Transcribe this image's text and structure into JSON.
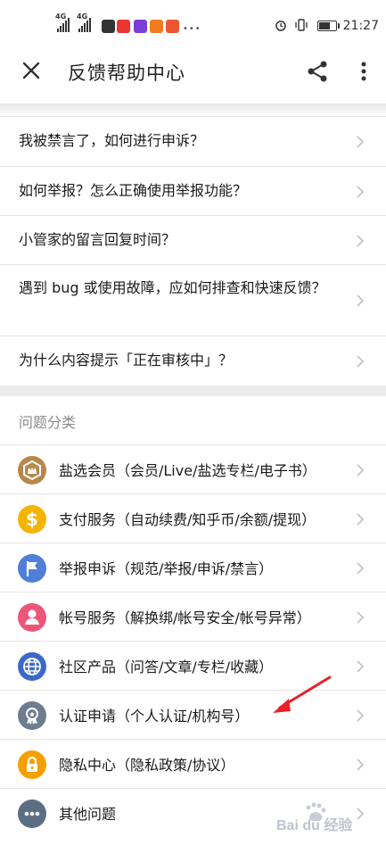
{
  "status_bar": {
    "network_1": "4G",
    "network_2": "4G",
    "time": "21:27",
    "battery_level": 0.7
  },
  "header": {
    "title": "反馈帮助中心"
  },
  "faq": [
    {
      "question": "我被禁言了，如何进行申诉？"
    },
    {
      "question": "如何举报？怎么正确使用举报功能？"
    },
    {
      "question": "小管家的留言回复时间？"
    },
    {
      "question": "遇到 bug 或使用故障，应如何排查和快速反馈？"
    },
    {
      "question": "为什么内容提示「正在审核中」？"
    }
  ],
  "categories": {
    "title": "问题分类",
    "items": [
      {
        "label": "盐选会员（会员/Live/盐选专栏/电子书）",
        "icon": "crown-icon",
        "color": "#b8874a"
      },
      {
        "label": "支付服务（自动续费/知乎币/余额/提现）",
        "icon": "dollar-icon",
        "color": "#f5b400"
      },
      {
        "label": "举报申诉（规范/举报/申诉/禁言）",
        "icon": "flag-icon",
        "color": "#4f7fd6"
      },
      {
        "label": "帐号服务（解换绑/帐号安全/帐号异常）",
        "icon": "person-icon",
        "color": "#ec5679"
      },
      {
        "label": "社区产品（问答/文章/专栏/收藏）",
        "icon": "globe-icon",
        "color": "#3c69c9"
      },
      {
        "label": "认证申请（个人认证/机构号）",
        "icon": "badge-icon",
        "color": "#6d7c8e"
      },
      {
        "label": "隐私中心（隐私政策/协议）",
        "icon": "lock-icon",
        "color": "#f5a000"
      },
      {
        "label": "其他问题",
        "icon": "more-icon",
        "color": "#5b6e84"
      }
    ]
  },
  "watermark": "Bai du 经验"
}
